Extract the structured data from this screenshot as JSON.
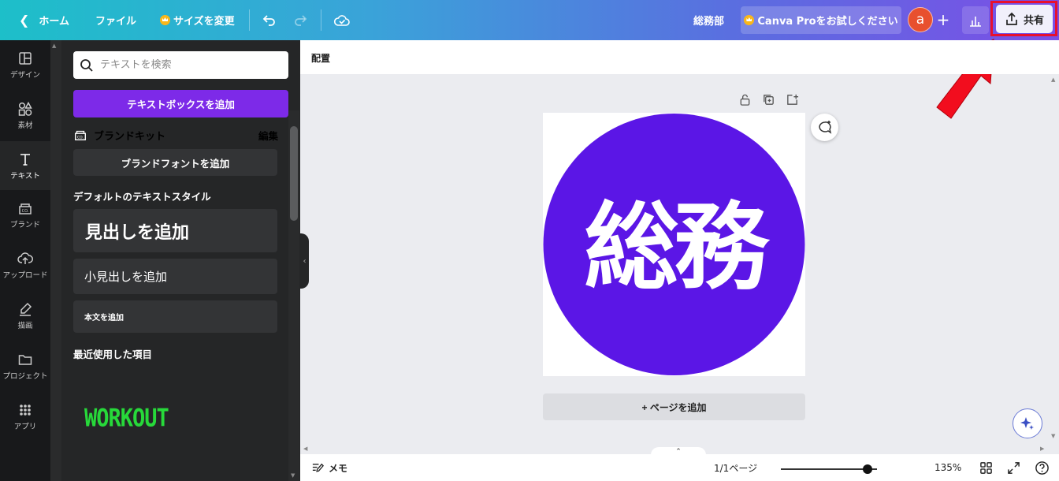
{
  "topbar": {
    "home": "ホーム",
    "file": "ファイル",
    "resize": "サイズを変更",
    "team": "総務部",
    "pro_trial": "Canva Proをお試しください",
    "avatar_letter": "a",
    "share": "共有"
  },
  "rail": {
    "items": [
      {
        "label": "デザイン",
        "icon": "layout-icon"
      },
      {
        "label": "素材",
        "icon": "elements-icon"
      },
      {
        "label": "テキスト",
        "icon": "text-icon"
      },
      {
        "label": "ブランド",
        "icon": "brand-icon"
      },
      {
        "label": "アップロード",
        "icon": "upload-icon"
      },
      {
        "label": "描画",
        "icon": "draw-icon"
      },
      {
        "label": "プロジェクト",
        "icon": "folder-icon"
      },
      {
        "label": "アプリ",
        "icon": "apps-icon"
      }
    ]
  },
  "panel": {
    "search_placeholder": "テキストを検索",
    "add_textbox": "テキストボックスを追加",
    "brand_kit": "ブランドキット",
    "edit": "編集",
    "add_brand_font": "ブランドフォントを追加",
    "default_styles": "デフォルトのテキストスタイル",
    "heading": "見出しを追加",
    "subheading": "小見出しを追加",
    "body": "本文を追加",
    "recent": "最近使用した項目",
    "recent_item": "WORKOUT"
  },
  "canvas": {
    "context_label": "配置",
    "design_text": "総務",
    "add_page": "+ ページを追加"
  },
  "bottombar": {
    "notes": "メモ",
    "pages": "1/1ページ",
    "zoom": "135%",
    "zoom_fraction": 0.9
  },
  "colors": {
    "accent": "#7d2ae8",
    "circle": "#5b16e6",
    "highlight": "#e8102d"
  }
}
